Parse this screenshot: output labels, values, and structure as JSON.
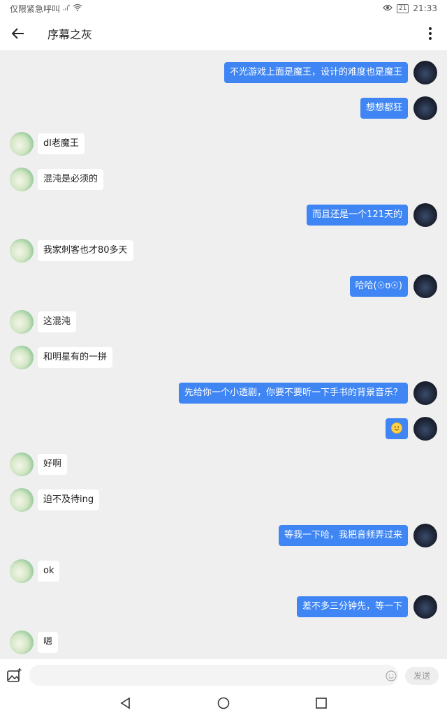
{
  "status_bar": {
    "left_text": "仅限紧急呼叫",
    "battery": "21",
    "time": "21:33"
  },
  "header": {
    "title": "序幕之灰"
  },
  "messages": [
    {
      "side": "me",
      "text": "不光游戏上面是魔王，设计的难度也是魔王"
    },
    {
      "side": "me",
      "text": "想想都狂"
    },
    {
      "side": "peer",
      "text": "dl老魔王"
    },
    {
      "side": "peer",
      "text": "混沌是必须的"
    },
    {
      "side": "me",
      "text": "而且还是一个121天的"
    },
    {
      "side": "peer",
      "text": "我家刺客也才80多天"
    },
    {
      "side": "me",
      "text": "哈哈(☉ʊ☉)"
    },
    {
      "side": "peer",
      "text": "这混沌"
    },
    {
      "side": "peer",
      "text": "和明星有的一拼"
    },
    {
      "side": "me",
      "text": "先给你一个小透剧，你要不要听一下手书的背景音乐？"
    },
    {
      "side": "me",
      "text": "",
      "emoji": "smile-emoji"
    },
    {
      "side": "peer",
      "text": "好啊"
    },
    {
      "side": "peer",
      "text": "迫不及待ing"
    },
    {
      "side": "me",
      "text": "等我一下哈，我把音频弄过来"
    },
    {
      "side": "peer",
      "text": "ok"
    },
    {
      "side": "me",
      "text": "差不多三分钟先，等一下"
    },
    {
      "side": "peer",
      "text": "嗯"
    }
  ],
  "input": {
    "placeholder": "",
    "send_label": "发送"
  },
  "colors": {
    "my_bubble": "#3f86f4",
    "peer_bubble": "#ffffff",
    "chat_background": "#efefef"
  }
}
